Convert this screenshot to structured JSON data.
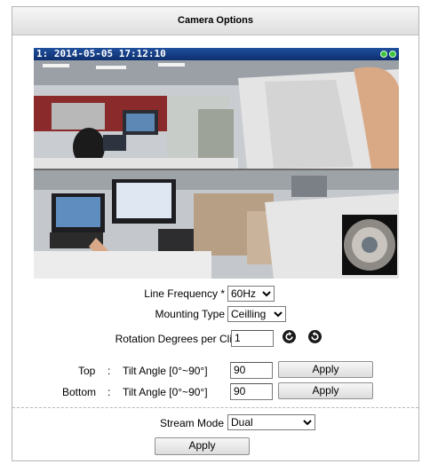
{
  "panel": {
    "title": "Camera Options"
  },
  "video": {
    "overlay_text": "1:  2014-05-05 17:12:10"
  },
  "line_frequency": {
    "label": "Line Frequency *",
    "value": "60Hz"
  },
  "mounting_type": {
    "label": "Mounting Type",
    "value": "Ceilling"
  },
  "rotation": {
    "label": "Rotation Degrees per Click",
    "value": "1",
    "icons": [
      "rotate-ccw-icon",
      "rotate-cw-icon"
    ]
  },
  "top_tilt": {
    "position": "Top",
    "separator": ":",
    "label": "Tilt Angle  [0°~90°]",
    "value": "90",
    "apply_label": "Apply"
  },
  "bottom_tilt": {
    "position": "Bottom",
    "separator": ":",
    "label": "Tilt Angle  [0°~90°]",
    "value": "90",
    "apply_label": "Apply"
  },
  "stream_mode": {
    "label": "Stream Mode",
    "value": "Dual"
  },
  "footer": {
    "apply_label": "Apply"
  }
}
